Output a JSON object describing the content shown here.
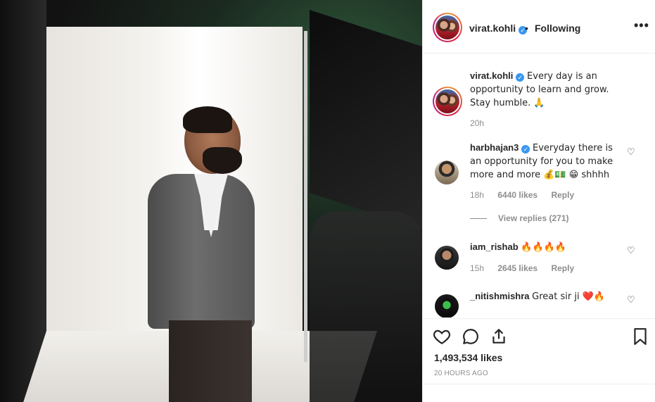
{
  "header": {
    "username": "virat.kohli",
    "verified_mark": "✓",
    "separator": "•",
    "follow_status": "Following",
    "more_label": "•••"
  },
  "caption": {
    "username": "virat.kohli",
    "verified_mark": "✓",
    "text": "Every day is an opportunity to learn and grow. Stay humble. 🙏",
    "age": "20h"
  },
  "comments": [
    {
      "username": "harbhajan3",
      "verified_mark": "✓",
      "text": "Everyday there is an opportunity for you to make more and more 💰💵 😁 shhhh",
      "age": "18h",
      "likes": "6440 likes",
      "reply_label": "Reply",
      "view_replies": "View replies (271)"
    },
    {
      "username": "iam_rishab",
      "text": "🔥🔥🔥🔥",
      "age": "15h",
      "likes": "2645 likes",
      "reply_label": "Reply"
    },
    {
      "username": "_nitishmishra",
      "text": "Great sir ji ❤️🔥"
    }
  ],
  "actions": {
    "like_icon": "heart-outline-icon",
    "comment_icon": "comment-bubble-icon",
    "share_icon": "share-upload-icon",
    "save_icon": "bookmark-icon",
    "likes_count": "1,493,534 likes",
    "posted": "20 HOURS AGO"
  },
  "colors": {
    "verified_blue": "#3897f0",
    "meta_gray": "#8e8e8e",
    "text": "#262626"
  }
}
